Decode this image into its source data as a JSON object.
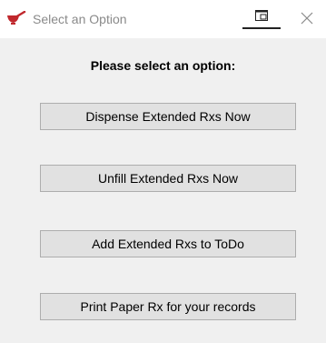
{
  "window": {
    "title": "Select an Option",
    "app_icon": "mortar-pestle-icon",
    "restore_icon": "window-restore-icon",
    "close_icon": "close-icon"
  },
  "dialog": {
    "heading": "Please select an option:",
    "options": [
      {
        "label": "Dispense Extended Rxs Now"
      },
      {
        "label": "Unfill Extended Rxs Now"
      },
      {
        "label": "Add Extended Rxs to ToDo"
      },
      {
        "label": "Print Paper Rx for your records"
      }
    ]
  },
  "colors": {
    "app_icon": "#c0282d",
    "button_face": "#e1e1e1",
    "button_border": "#adadad",
    "background": "#f0f0f0"
  }
}
